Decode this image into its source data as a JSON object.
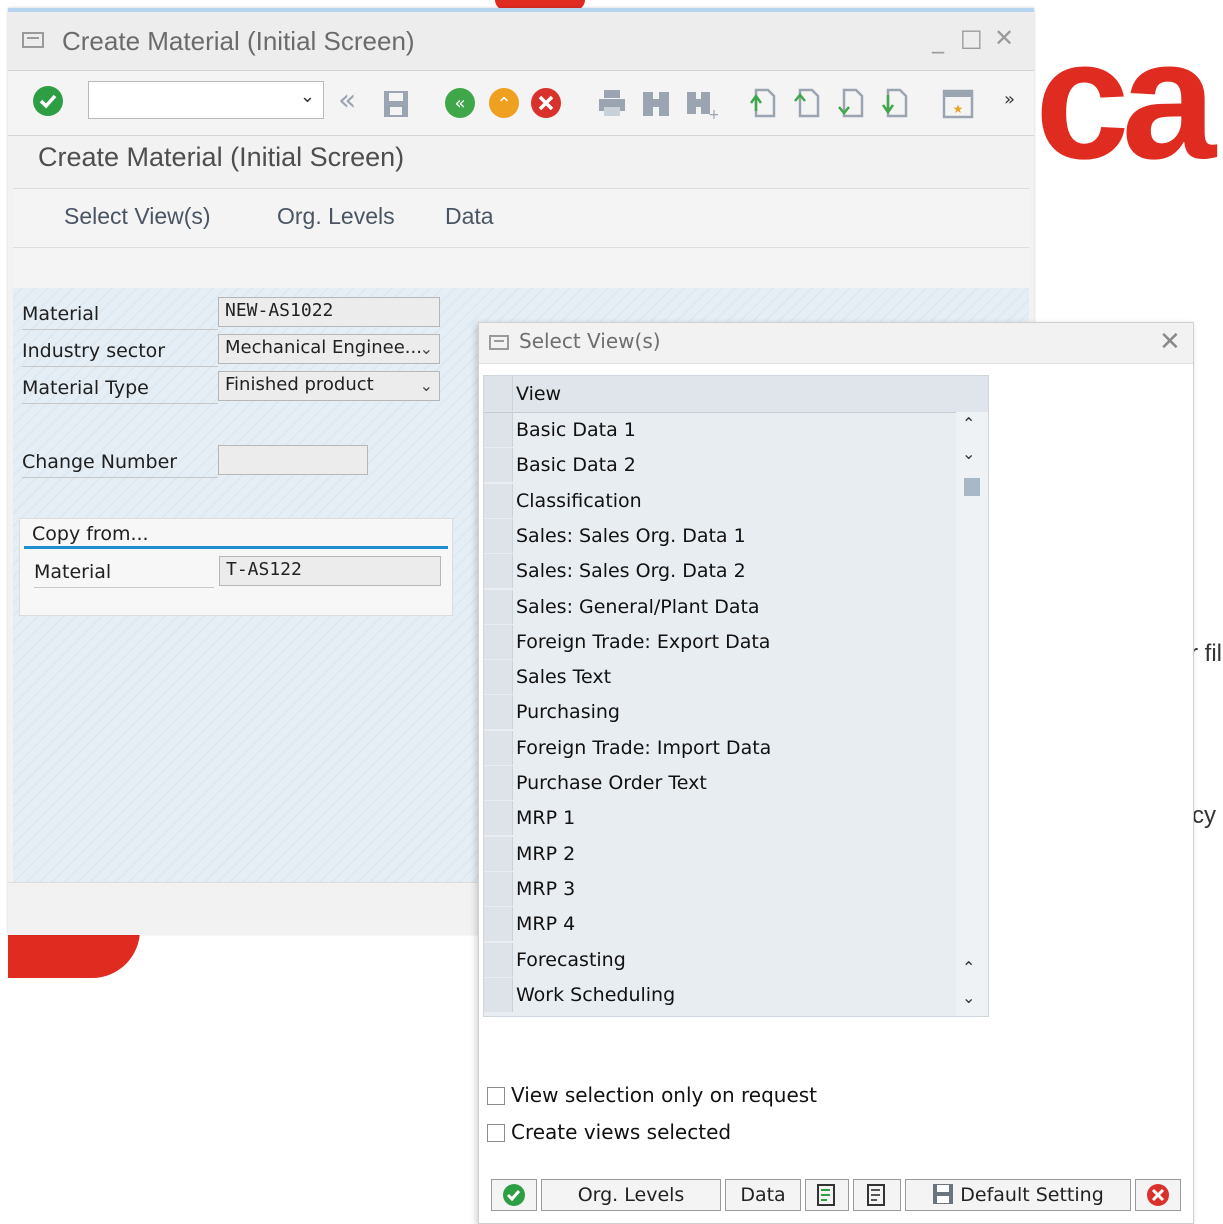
{
  "background": {
    "brand_text": "ca",
    "frag1": "r fil",
    "frag2": "cy"
  },
  "window": {
    "title": "Create Material (Initial Screen)",
    "controls": {
      "minimize": "_",
      "maximize": "□",
      "close": "✕"
    }
  },
  "toolbar": {
    "command_field": {
      "value": "",
      "placeholder": ""
    },
    "more": "»"
  },
  "page": {
    "title": "Create Material (Initial Screen)",
    "app_buttons": [
      "Select View(s)",
      "Org. Levels",
      "Data"
    ]
  },
  "form": {
    "material": {
      "label": "Material",
      "value": "NEW-AS1022"
    },
    "industry_sector": {
      "label": "Industry sector",
      "value": "Mechanical Enginee..."
    },
    "material_type": {
      "label": "Material Type",
      "value": "Finished product"
    },
    "change_number": {
      "label": "Change Number",
      "value": ""
    },
    "copy_from": {
      "title": "Copy from...",
      "material_label": "Material",
      "material_value": "T-AS122"
    }
  },
  "dialog": {
    "title": "Select View(s)",
    "table": {
      "header": "View",
      "rows": [
        "Basic Data 1",
        "Basic Data 2",
        "Classification",
        "Sales: Sales Org. Data 1",
        "Sales: Sales Org. Data 2",
        "Sales: General/Plant Data",
        "Foreign Trade: Export Data",
        "Sales Text",
        "Purchasing",
        "Foreign Trade: Import Data",
        "Purchase Order Text",
        "MRP 1",
        "MRP 2",
        "MRP 3",
        "MRP 4",
        "Forecasting",
        "Work Scheduling"
      ]
    },
    "options": {
      "view_selection": {
        "label": "View selection only on request",
        "checked": false
      },
      "create_views": {
        "label": "Create views selected",
        "checked": false
      }
    },
    "buttons": {
      "org_levels": "Org. Levels",
      "data": "Data",
      "default_setting": "Default Setting"
    }
  },
  "colors": {
    "brand_red": "#e02b20",
    "accent_blue": "#1d8fcf",
    "ok_green": "#2e9e45",
    "cancel_red": "#d9312b",
    "nav_green": "#3fa64a",
    "nav_orange": "#f0a020"
  }
}
